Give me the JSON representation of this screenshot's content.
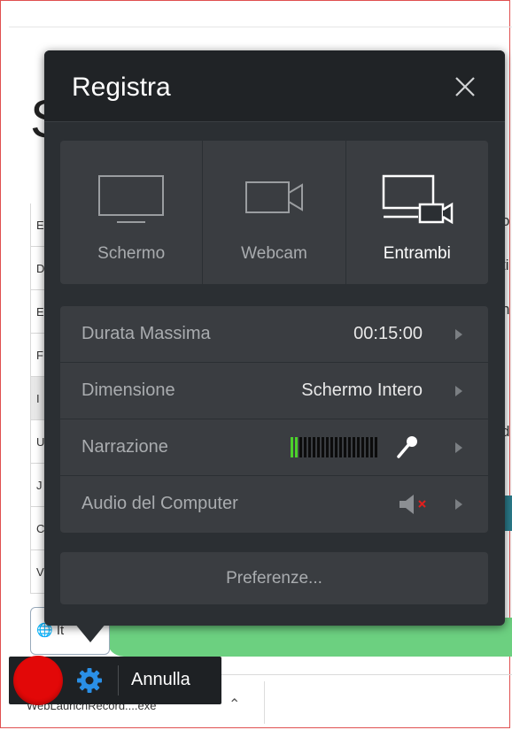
{
  "dialog": {
    "title": "Registra",
    "sources": [
      {
        "label": "Schermo",
        "icon": "monitor-icon",
        "selected": false
      },
      {
        "label": "Webcam",
        "icon": "webcam-icon",
        "selected": false
      },
      {
        "label": "Entrambi",
        "icon": "screen-and-webcam-icon",
        "selected": true
      }
    ],
    "settings": [
      {
        "label": "Durata Massima",
        "value": "00:15:00"
      },
      {
        "label": "Dimensione",
        "value": "Schermo Intero"
      },
      {
        "label": "Narrazione",
        "value": ""
      },
      {
        "label": "Audio del Computer",
        "value": ""
      }
    ],
    "narration_level": 0.1,
    "computer_audio_muted": true,
    "preferences_label": "Preferenze..."
  },
  "toolbar": {
    "cancel_label": "Annulla"
  },
  "download": {
    "filename": "WebLaunchRecord....exe"
  },
  "background": {
    "lang_label": "It",
    "table_rows": [
      "E",
      "D",
      "E",
      "F",
      "I",
      "U",
      "J",
      "C",
      "V"
    ]
  },
  "colors": {
    "dialog_bg": "#2b2f33",
    "panel_bg": "#3a3d41",
    "record_red": "#e20808",
    "meter_green": "#4cd12b",
    "gear_blue": "#2a8fe6",
    "mute_red": "#e0201e"
  }
}
